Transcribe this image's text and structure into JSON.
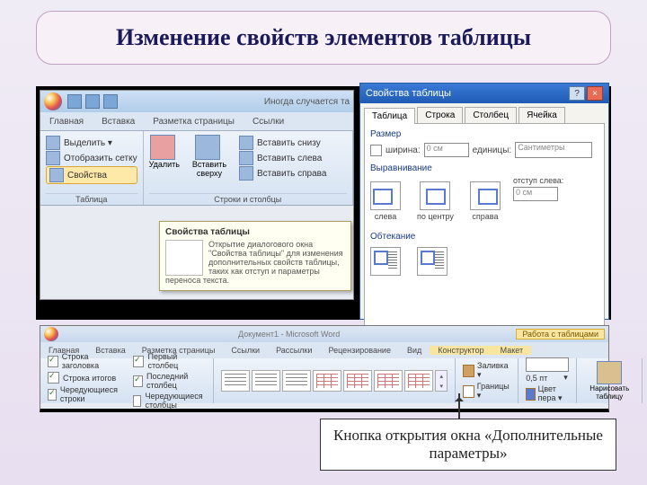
{
  "slide": {
    "title": "Изменение свойств элементов таблицы",
    "callout": "Кнопка открытия окна «Дополнительные параметры»"
  },
  "left": {
    "title_fragment": "Иногда случается та",
    "tabs": [
      "Главная",
      "Вставка",
      "Разметка страницы",
      "Ссылки"
    ],
    "group1": {
      "items": [
        "Выделить ▾",
        "Отобразить сетку",
        "Свойства"
      ],
      "title": "Таблица"
    },
    "group2": {
      "delete": "Удалить",
      "insert_top": "Вставить сверху",
      "items": [
        "Вставить снизу",
        "Вставить слева",
        "Вставить справа"
      ],
      "title": "Строки и столбцы"
    },
    "tooltip": {
      "heading": "Свойства таблицы",
      "body": "Открытие диалогового окна \"Свойства таблицы\" для изменения дополнительных свойств таблицы, таких как отступ и параметры переноса текста."
    }
  },
  "dialog": {
    "title": "Свойства таблицы",
    "tabs": [
      "Таблица",
      "Строка",
      "Столбец",
      "Ячейка"
    ],
    "size_label": "Размер",
    "width_label": "ширина:",
    "width_value": "0 см",
    "units_label": "единицы:",
    "units_value": "Сантиметры",
    "align_label": "Выравнивание",
    "indent_label": "отступ слева:",
    "indent_value": "0 см",
    "align_opts": [
      "слева",
      "по центру",
      "справа"
    ],
    "wrap_label": "Обтекание"
  },
  "bottom": {
    "doc_title": "Документ1 - Microsoft Word",
    "tools_label": "Работа с таблицами",
    "tabs": [
      "Главная",
      "Вставка",
      "Разметка страницы",
      "Ссылки",
      "Рассылки",
      "Рецензирование",
      "Вид"
    ],
    "tool_tabs": [
      "Конструктор",
      "Макет"
    ],
    "checks_col1": [
      "Строка заголовка",
      "Строка итогов",
      "Чередующиеся строки"
    ],
    "checks_col2": [
      "Первый столбец",
      "Последний столбец",
      "Чередующиеся столбцы"
    ],
    "shading": "Заливка ▾",
    "borders": "Границы ▾",
    "pen_width": "0,5 пт",
    "pen_color": "Цвет пера ▾",
    "draw": "Нарисовать таблицу"
  }
}
